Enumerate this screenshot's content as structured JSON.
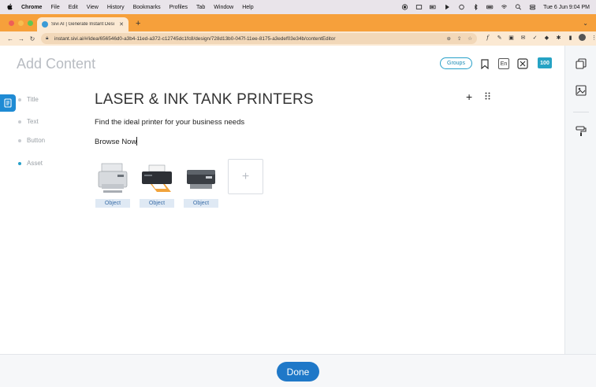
{
  "os_menubar": {
    "app_name": "Chrome",
    "menus": [
      "File",
      "Edit",
      "View",
      "History",
      "Bookmarks",
      "Profiles",
      "Tab",
      "Window",
      "Help"
    ],
    "clock": "Tue 6 Jun  9:04 PM"
  },
  "browser": {
    "tab_title": "Sivi AI | Generate Instant Desi",
    "url": "instant.sivi.ai/#/idea/656546d0-a3b4-11ed-a372-c12745dc1fc8/design/728d13b0-047f-11ee-8175-a3edef03e34b/contentEditor",
    "new_tab_symbol": "+"
  },
  "app": {
    "header_title": "Add Content",
    "groups_label": "Groups",
    "language_label": "En",
    "score_badge": "100",
    "fields": [
      {
        "label": "Title"
      },
      {
        "label": "Text"
      },
      {
        "label": "Button"
      },
      {
        "label": "Asset"
      }
    ],
    "content": {
      "title": "LASER & INK TANK PRINTERS",
      "text": "Find the ideal printer for your business needs",
      "button": "Browse Now"
    },
    "assets": [
      {
        "label": "Object",
        "icon": "printer-image-1"
      },
      {
        "label": "Object",
        "icon": "printer-image-2"
      },
      {
        "label": "Object",
        "icon": "printer-image-3"
      }
    ],
    "add_asset_symbol": "+",
    "add_symbol": "+",
    "done_label": "Done"
  }
}
